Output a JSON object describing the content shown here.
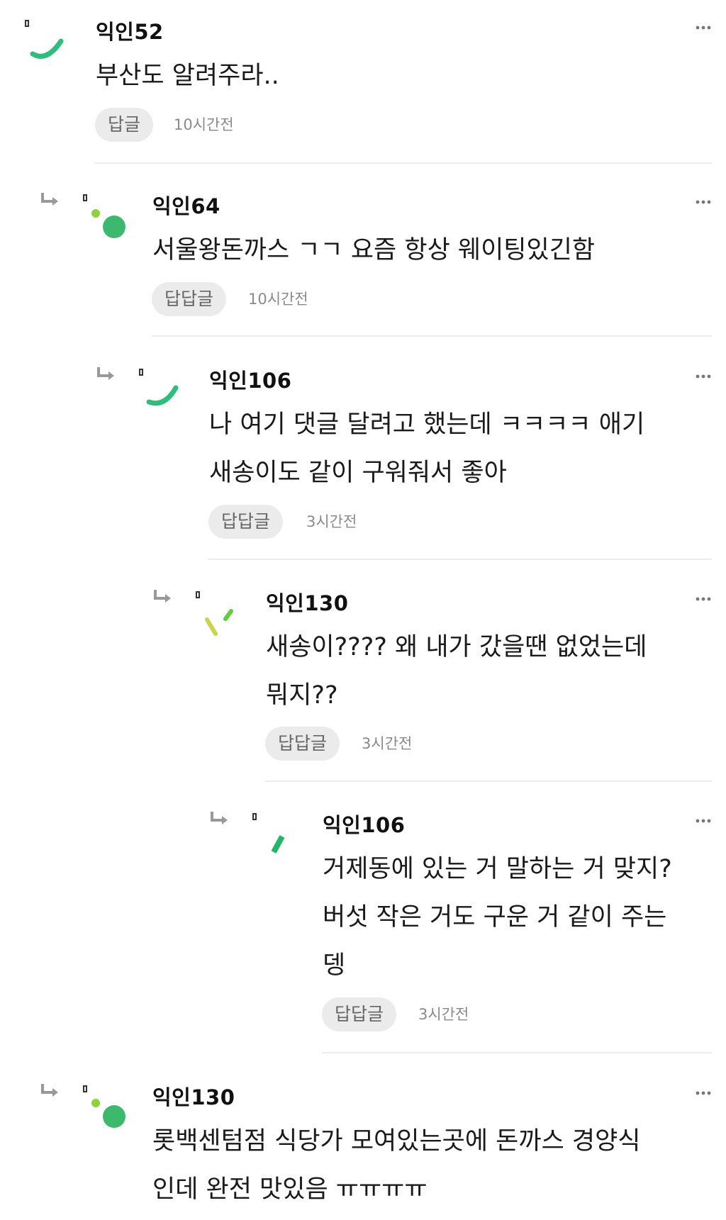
{
  "comments": [
    {
      "author": "익인52",
      "lines": [
        "부산도 알려주라.."
      ],
      "reply_label": "답글",
      "time": "10시간전"
    },
    {
      "author": "익인64",
      "lines": [
        "서울왕돈까스 ㄱㄱ 요즘 항상 웨이팅있긴함"
      ],
      "reply_label": "답답글",
      "time": "10시간전"
    },
    {
      "author": "익인106",
      "lines": [
        "나 여기 댓글 달려고 했는데 ㅋㅋㅋㅋ 애기",
        "새송이도 같이 구워줘서 좋아"
      ],
      "reply_label": "답답글",
      "time": "3시간전"
    },
    {
      "author": "익인130",
      "lines": [
        "새송이???? 왜 내가 갔을땐 없었는데",
        "뭐지??"
      ],
      "reply_label": "답답글",
      "time": "3시간전"
    },
    {
      "author": "익인106",
      "lines": [
        "거제동에 있는 거 말하는 거 맞지?",
        "버섯 작은 거도 구운 거 같이 주는",
        "뎅"
      ],
      "reply_label": "답답글",
      "time": "3시간전"
    },
    {
      "author": "익인130",
      "lines": [
        "롯백센텀점 식당가 모여있는곳에 돈까스 경양식",
        "인데 완전 맛있음 ㅠㅠㅠㅠ"
      ]
    }
  ],
  "icons": {
    "reply": "reply-arrow-icon",
    "more": "more-dots-icon",
    "pin": "pin-marker-icon"
  },
  "colors": {
    "avatar_green": "#2bbf7a",
    "avatar_light_green": "#8ed13a",
    "avatar_yellow": "#c9d64a",
    "button_bg": "#ebebeb",
    "meta_gray": "#8a8a8a",
    "divider": "#ececec"
  }
}
